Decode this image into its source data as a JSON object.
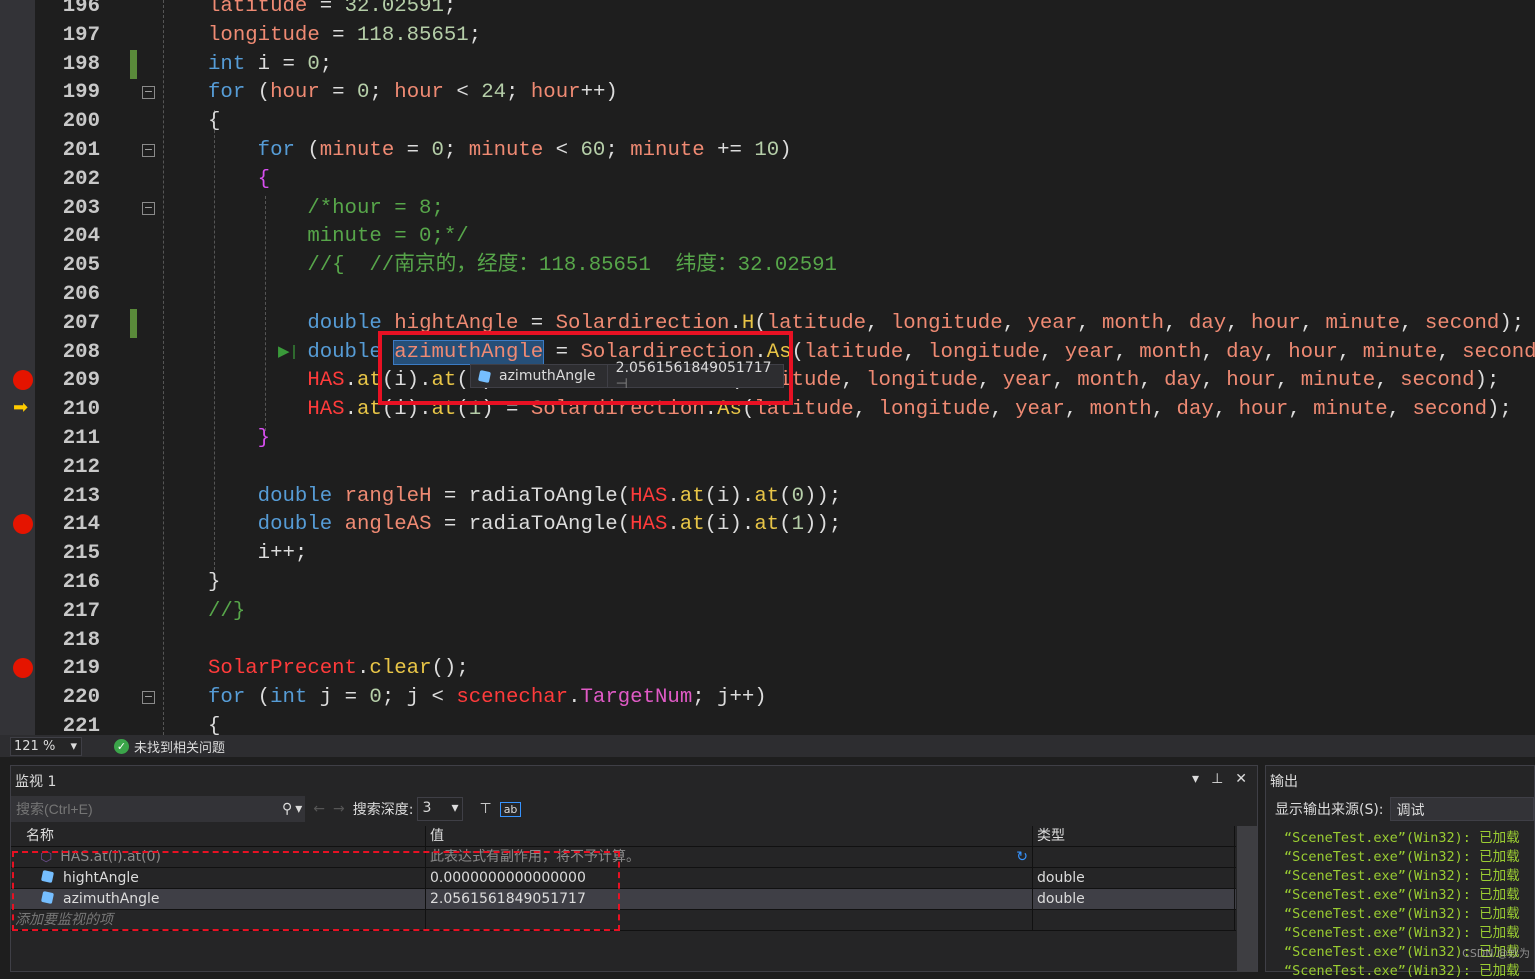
{
  "editor": {
    "lines": [
      {
        "n": "196",
        "t": [
          [
            "latitude",
            "var"
          ],
          [
            " = ",
            "pl"
          ],
          [
            "32.02591",
            "num"
          ],
          [
            ";",
            "pl"
          ]
        ]
      },
      {
        "n": "197",
        "t": [
          [
            "longitude",
            "var"
          ],
          [
            " = ",
            "pl"
          ],
          [
            "118.85651",
            "num"
          ],
          [
            ";",
            "pl"
          ]
        ]
      },
      {
        "n": "198",
        "t": [
          [
            "int",
            "kw"
          ],
          [
            " i = ",
            "pl"
          ],
          [
            "0",
            "num"
          ],
          [
            ";",
            "pl"
          ]
        ]
      },
      {
        "n": "199",
        "t": [
          [
            "for",
            "kw"
          ],
          [
            " (",
            "pl"
          ],
          [
            "hour",
            "var"
          ],
          [
            " = ",
            "pl"
          ],
          [
            "0",
            "num"
          ],
          [
            "; ",
            "pl"
          ],
          [
            "hour",
            "var"
          ],
          [
            " < ",
            "pl"
          ],
          [
            "24",
            "num"
          ],
          [
            "; ",
            "pl"
          ],
          [
            "hour",
            "var"
          ],
          [
            "++)",
            "pl"
          ]
        ]
      },
      {
        "n": "200",
        "t": [
          [
            "{",
            "pl"
          ]
        ]
      },
      {
        "n": "201",
        "t": [
          [
            "    for",
            "kw"
          ],
          [
            " (",
            "pl"
          ],
          [
            "minute",
            "var"
          ],
          [
            " = ",
            "pl"
          ],
          [
            "0",
            "num"
          ],
          [
            "; ",
            "pl"
          ],
          [
            "minute",
            "var"
          ],
          [
            " < ",
            "pl"
          ],
          [
            "60",
            "num"
          ],
          [
            "; ",
            "pl"
          ],
          [
            "minute",
            "var"
          ],
          [
            " += ",
            "pl"
          ],
          [
            "10",
            "num"
          ],
          [
            ")",
            "pl"
          ]
        ]
      },
      {
        "n": "202",
        "t": [
          [
            "    {",
            "br1"
          ]
        ]
      },
      {
        "n": "203",
        "t": [
          [
            "        /*hour = 8;",
            "cm"
          ]
        ]
      },
      {
        "n": "204",
        "t": [
          [
            "        minute = 0;*/",
            "cm"
          ]
        ]
      },
      {
        "n": "205",
        "t": [
          [
            "        //{  //南京的，经度：118.85651  纬度：32.02591",
            "cm"
          ]
        ]
      },
      {
        "n": "206",
        "t": []
      },
      {
        "n": "207",
        "t": [
          [
            "        double",
            "kw"
          ],
          [
            " ",
            "pl"
          ],
          [
            "hightAngle",
            "var"
          ],
          [
            " = ",
            "pl"
          ],
          [
            "Solardirection",
            "var"
          ],
          [
            ".",
            "pl"
          ],
          [
            "H",
            "fn"
          ],
          [
            "(",
            "pl"
          ],
          [
            "latitude",
            "var"
          ],
          [
            ", ",
            "pl"
          ],
          [
            "longitude",
            "var"
          ],
          [
            ", ",
            "pl"
          ],
          [
            "year",
            "var"
          ],
          [
            ", ",
            "pl"
          ],
          [
            "month",
            "var"
          ],
          [
            ", ",
            "pl"
          ],
          [
            "day",
            "var"
          ],
          [
            ", ",
            "pl"
          ],
          [
            "hour",
            "var"
          ],
          [
            ", ",
            "pl"
          ],
          [
            "minute",
            "var"
          ],
          [
            ", ",
            "pl"
          ],
          [
            "second",
            "var"
          ],
          [
            ");",
            "pl"
          ]
        ]
      },
      {
        "n": "208",
        "t": [
          [
            "        double",
            "kw"
          ],
          [
            " ",
            "pl"
          ],
          [
            "azimuthAngle",
            "var sel"
          ],
          [
            " = ",
            "pl"
          ],
          [
            "Solardirection",
            "var"
          ],
          [
            ".",
            "pl"
          ],
          [
            "As",
            "fn"
          ],
          [
            "(",
            "pl"
          ],
          [
            "latitude",
            "var"
          ],
          [
            ", ",
            "pl"
          ],
          [
            "longitude",
            "var"
          ],
          [
            ", ",
            "pl"
          ],
          [
            "year",
            "var"
          ],
          [
            ", ",
            "pl"
          ],
          [
            "month",
            "var"
          ],
          [
            ", ",
            "pl"
          ],
          [
            "day",
            "var"
          ],
          [
            ", ",
            "pl"
          ],
          [
            "hour",
            "var"
          ],
          [
            ", ",
            "pl"
          ],
          [
            "minute",
            "var"
          ],
          [
            ", ",
            "pl"
          ],
          [
            "second",
            "var"
          ],
          [
            ");",
            "pl"
          ]
        ]
      },
      {
        "n": "209",
        "t": [
          [
            "        HAS",
            "glob"
          ],
          [
            ".",
            "pl"
          ],
          [
            "at",
            "fn"
          ],
          [
            "(i).",
            "pl"
          ],
          [
            "at",
            "fn"
          ],
          [
            "(",
            "pl"
          ],
          [
            "0",
            "num"
          ],
          [
            ") = ",
            "pl"
          ],
          [
            "Solardirection",
            "var"
          ],
          [
            ".",
            "pl"
          ],
          [
            "H",
            "fn"
          ],
          [
            "(",
            "pl"
          ],
          [
            "latitude",
            "var"
          ],
          [
            ", ",
            "pl"
          ],
          [
            "longitude",
            "var"
          ],
          [
            ", ",
            "pl"
          ],
          [
            "year",
            "var"
          ],
          [
            ", ",
            "pl"
          ],
          [
            "month",
            "var"
          ],
          [
            ", ",
            "pl"
          ],
          [
            "day",
            "var"
          ],
          [
            ", ",
            "pl"
          ],
          [
            "hour",
            "var"
          ],
          [
            ", ",
            "pl"
          ],
          [
            "minute",
            "var"
          ],
          [
            ", ",
            "pl"
          ],
          [
            "second",
            "var"
          ],
          [
            ");",
            "pl"
          ]
        ]
      },
      {
        "n": "210",
        "t": [
          [
            "        HAS",
            "glob"
          ],
          [
            ".",
            "pl"
          ],
          [
            "at",
            "fn"
          ],
          [
            "(i).",
            "pl"
          ],
          [
            "at",
            "fn"
          ],
          [
            "(",
            "pl"
          ],
          [
            "1",
            "num"
          ],
          [
            ") = ",
            "pl"
          ],
          [
            "Solardirection",
            "var"
          ],
          [
            ".",
            "pl"
          ],
          [
            "As",
            "fn"
          ],
          [
            "(",
            "pl"
          ],
          [
            "latitude",
            "var"
          ],
          [
            ", ",
            "pl"
          ],
          [
            "longitude",
            "var"
          ],
          [
            ", ",
            "pl"
          ],
          [
            "year",
            "var"
          ],
          [
            ", ",
            "pl"
          ],
          [
            "month",
            "var"
          ],
          [
            ", ",
            "pl"
          ],
          [
            "day",
            "var"
          ],
          [
            ", ",
            "pl"
          ],
          [
            "hour",
            "var"
          ],
          [
            ", ",
            "pl"
          ],
          [
            "minute",
            "var"
          ],
          [
            ", ",
            "pl"
          ],
          [
            "second",
            "var"
          ],
          [
            ");",
            "pl"
          ]
        ]
      },
      {
        "n": "211",
        "t": [
          [
            "    }",
            "br1"
          ]
        ]
      },
      {
        "n": "212",
        "t": []
      },
      {
        "n": "213",
        "t": [
          [
            "    double",
            "kw"
          ],
          [
            " ",
            "pl"
          ],
          [
            "rangleH",
            "var"
          ],
          [
            " = radiaToAngle(",
            "pl"
          ],
          [
            "HAS",
            "glob"
          ],
          [
            ".",
            "pl"
          ],
          [
            "at",
            "fn"
          ],
          [
            "(i).",
            "pl"
          ],
          [
            "at",
            "fn"
          ],
          [
            "(",
            "pl"
          ],
          [
            "0",
            "num"
          ],
          [
            "));",
            "pl"
          ]
        ]
      },
      {
        "n": "214",
        "t": [
          [
            "    double",
            "kw"
          ],
          [
            " ",
            "pl"
          ],
          [
            "angleAS",
            "var"
          ],
          [
            " = radiaToAngle(",
            "pl"
          ],
          [
            "HAS",
            "glob"
          ],
          [
            ".",
            "pl"
          ],
          [
            "at",
            "fn"
          ],
          [
            "(i).",
            "pl"
          ],
          [
            "at",
            "fn"
          ],
          [
            "(",
            "pl"
          ],
          [
            "1",
            "num"
          ],
          [
            "));",
            "pl"
          ]
        ]
      },
      {
        "n": "215",
        "t": [
          [
            "    i++;",
            "pl"
          ]
        ]
      },
      {
        "n": "216",
        "t": [
          [
            "}",
            "pl"
          ]
        ]
      },
      {
        "n": "217",
        "t": [
          [
            "//}",
            "cm"
          ]
        ]
      },
      {
        "n": "218",
        "t": []
      },
      {
        "n": "219",
        "t": [
          [
            "SolarPrecent",
            "glob"
          ],
          [
            ".",
            "pl"
          ],
          [
            "clear",
            "fn"
          ],
          [
            "();",
            "pl"
          ]
        ]
      },
      {
        "n": "220",
        "t": [
          [
            "for",
            "kw"
          ],
          [
            " (",
            "pl"
          ],
          [
            "int",
            "kw"
          ],
          [
            " j = ",
            "pl"
          ],
          [
            "0",
            "num"
          ],
          [
            "; j < ",
            "pl"
          ],
          [
            "scenechar",
            "glob"
          ],
          [
            ".",
            "pl"
          ],
          [
            "TargetNum",
            "mem"
          ],
          [
            "; j++)",
            "pl"
          ]
        ]
      },
      {
        "n": "221",
        "t": [
          [
            "{",
            "pl"
          ]
        ]
      }
    ],
    "breakpoints": [
      "209",
      "214",
      "219"
    ],
    "current_line": "210",
    "datatip": {
      "name": "azimuthAngle",
      "value": "2.0561561849051717"
    }
  },
  "status": {
    "zoom": "121 %",
    "issues": "未找到相关问题"
  },
  "watch": {
    "title": "监视 1",
    "search_placeholder": "搜索(Ctrl+E)",
    "depth_label": "搜索深度:",
    "depth_value": "3",
    "columns": [
      "名称",
      "值",
      "类型"
    ],
    "rows": [
      {
        "name": "HAS.at(i).at(0)",
        "value": "此表达式有副作用，将不予计算。",
        "type": ""
      },
      {
        "name": "hightAngle",
        "value": "0.0000000000000000",
        "type": "double"
      },
      {
        "name": "azimuthAngle",
        "value": "2.0561561849051717",
        "type": "double"
      }
    ],
    "add_placeholder": "添加要监视的项"
  },
  "output": {
    "title": "输出",
    "source_label": "显示输出来源(S):",
    "source_value": "调试",
    "lines": [
      "“SceneTest.exe”(Win32): 已加载",
      "“SceneTest.exe”(Win32): 已加载",
      "“SceneTest.exe”(Win32): 已加载",
      "“SceneTest.exe”(Win32): 已加载",
      "“SceneTest.exe”(Win32): 已加载",
      "“SceneTest.exe”(Win32): 已加载",
      "“SceneTest.exe”(Win32): 已加载",
      "“SceneTest.exe”(Win32): 已加载"
    ]
  },
  "watermark": "CSDN @妙为"
}
